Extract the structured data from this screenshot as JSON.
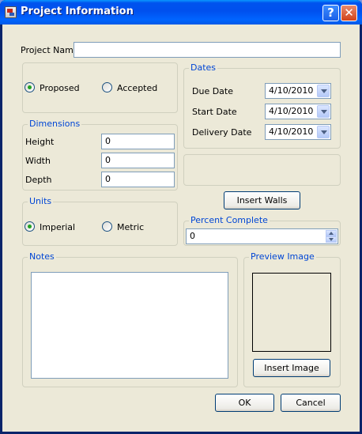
{
  "window": {
    "title": "Project Information",
    "help_symbol": "?",
    "close_symbol": "✕"
  },
  "project_name": {
    "label": "Project Name",
    "value": ""
  },
  "status": {
    "options": [
      {
        "label": "Proposed",
        "checked": true
      },
      {
        "label": "Accepted",
        "checked": false
      }
    ]
  },
  "dates": {
    "title": "Dates",
    "due": {
      "label": "Due Date",
      "value": "4/10/2010"
    },
    "start": {
      "label": "Start Date",
      "value": "4/10/2010"
    },
    "delivery": {
      "label": "Delivery Date",
      "value": "4/10/2010"
    }
  },
  "dimensions": {
    "title": "Dimensions",
    "height": {
      "label": "Height",
      "value": "0"
    },
    "width": {
      "label": "Width",
      "value": "0"
    },
    "depth": {
      "label": "Depth",
      "value": "0"
    }
  },
  "walls_panel": {
    "button_label": "Insert Walls"
  },
  "units": {
    "title": "Units",
    "options": [
      {
        "label": "Imperial",
        "checked": true
      },
      {
        "label": "Metric",
        "checked": false
      }
    ]
  },
  "percent_complete": {
    "title": "Percent Complete",
    "value": "0"
  },
  "notes": {
    "title": "Notes",
    "value": ""
  },
  "preview_image": {
    "title": "Preview Image",
    "button_label": "Insert Image"
  },
  "footer": {
    "ok_label": "OK",
    "cancel_label": "Cancel"
  },
  "colors": {
    "group_title": "#0046d5",
    "face": "#ece9d8",
    "title_bar": "#0050ee"
  },
  "icons": [
    "app-icon",
    "help-icon",
    "close-icon",
    "chevron-down-icon",
    "spin-up-icon",
    "spin-down-icon"
  ]
}
